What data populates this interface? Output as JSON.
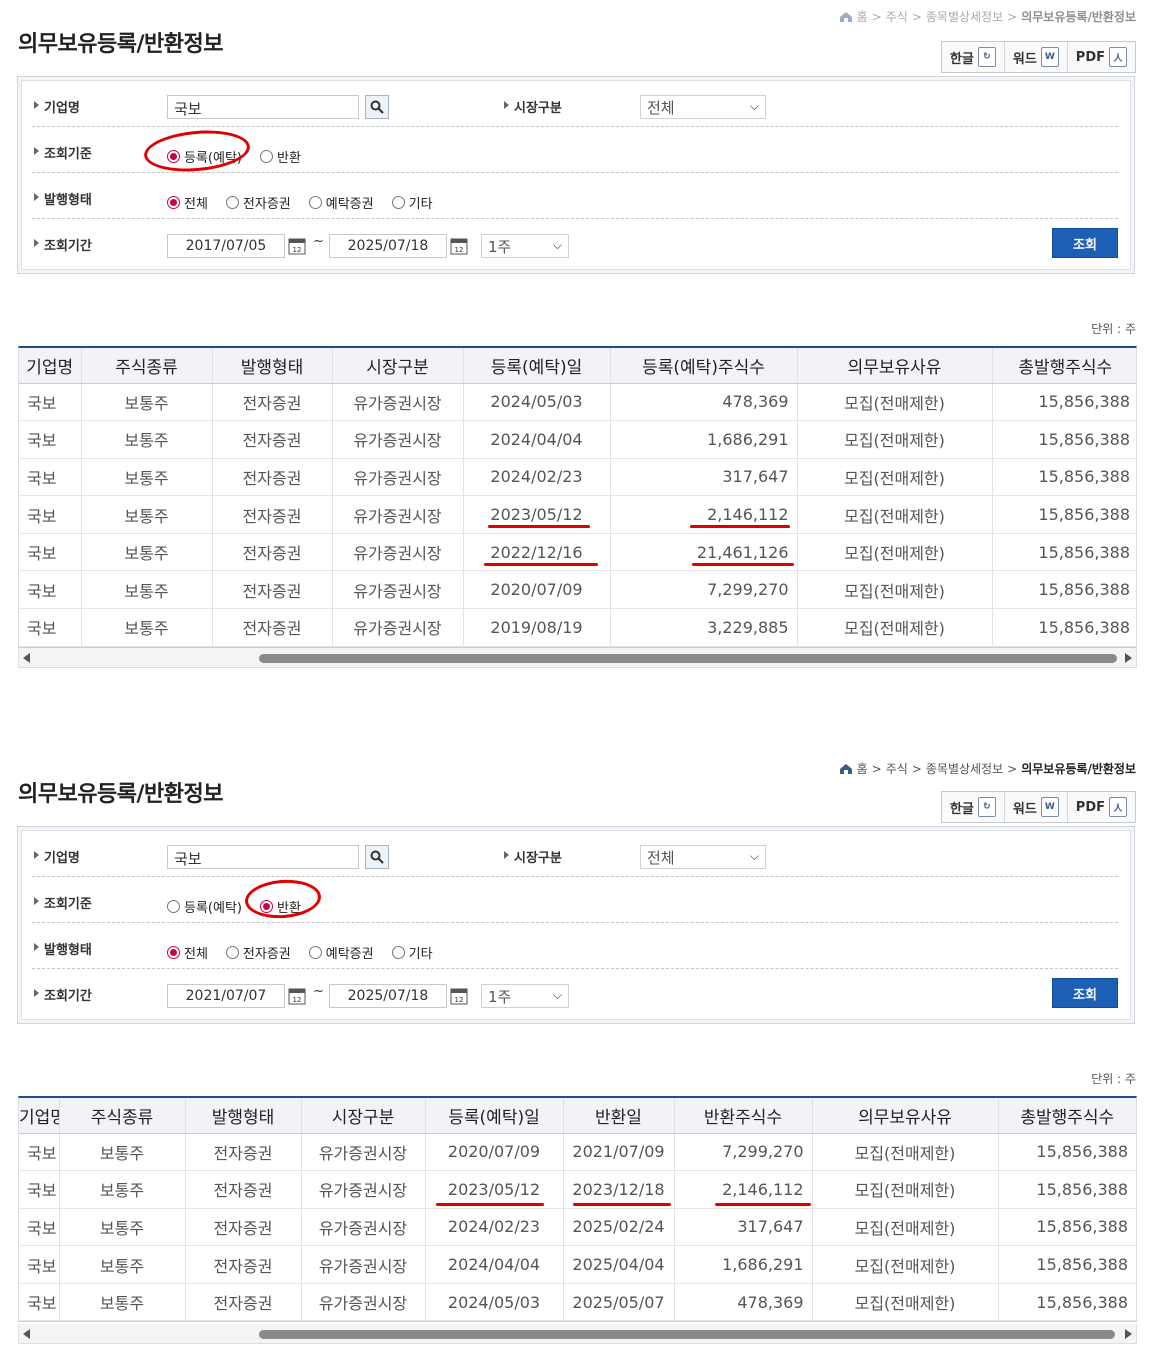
{
  "panel1": {
    "breadcrumb": [
      "홈",
      "주식",
      "종목별상세정보",
      "의무보유등록/반환정보"
    ],
    "title": "의무보유등록/반환정보",
    "export": [
      "한글",
      "워드",
      "PDF"
    ],
    "form": {
      "company_label": "기업명",
      "company_value": "국보",
      "market_label": "시장구분",
      "market_value": "전체",
      "basis_label": "조회기준",
      "basis_options": [
        "등록(예탁)",
        "반환"
      ],
      "basis_selected": "등록(예탁)",
      "type_label": "발행형태",
      "type_options": [
        "전체",
        "전자증권",
        "예탁증권",
        "기타"
      ],
      "type_selected": "전체",
      "period_label": "조회기간",
      "date_from": "2017/07/05",
      "date_to": "2025/07/18",
      "period_select": "1주",
      "submit": "조회"
    },
    "unit": "단위 : 주",
    "table": {
      "headers": [
        "기업명",
        "주식종류",
        "발행형태",
        "시장구분",
        "등록(예탁)일",
        "등록(예탁)주식수",
        "의무보유사유",
        "총발행주식수"
      ],
      "rows": [
        [
          "국보",
          "보통주",
          "전자증권",
          "유가증권시장",
          "2024/05/03",
          "478,369",
          "모집(전매제한)",
          "15,856,388"
        ],
        [
          "국보",
          "보통주",
          "전자증권",
          "유가증권시장",
          "2024/04/04",
          "1,686,291",
          "모집(전매제한)",
          "15,856,388"
        ],
        [
          "국보",
          "보통주",
          "전자증권",
          "유가증권시장",
          "2024/02/23",
          "317,647",
          "모집(전매제한)",
          "15,856,388"
        ],
        [
          "국보",
          "보통주",
          "전자증권",
          "유가증권시장",
          "2023/05/12",
          "2,146,112",
          "모집(전매제한)",
          "15,856,388"
        ],
        [
          "국보",
          "보통주",
          "전자증권",
          "유가증권시장",
          "2022/12/16",
          "21,461,126",
          "모집(전매제한)",
          "15,856,388"
        ],
        [
          "국보",
          "보통주",
          "전자증권",
          "유가증권시장",
          "2020/07/09",
          "7,299,270",
          "모집(전매제한)",
          "15,856,388"
        ],
        [
          "국보",
          "보통주",
          "전자증권",
          "유가증권시장",
          "2019/08/19",
          "3,229,885",
          "모집(전매제한)",
          "15,856,388"
        ]
      ]
    }
  },
  "panel2": {
    "breadcrumb": [
      "홈",
      "주식",
      "종목별상세정보",
      "의무보유등록/반환정보"
    ],
    "title": "의무보유등록/반환정보",
    "export": [
      "한글",
      "워드",
      "PDF"
    ],
    "form": {
      "company_label": "기업명",
      "company_value": "국보",
      "market_label": "시장구분",
      "market_value": "전체",
      "basis_label": "조회기준",
      "basis_options": [
        "등록(예탁)",
        "반환"
      ],
      "basis_selected": "반환",
      "type_label": "발행형태",
      "type_options": [
        "전체",
        "전자증권",
        "예탁증권",
        "기타"
      ],
      "type_selected": "전체",
      "period_label": "조회기간",
      "date_from": "2021/07/07",
      "date_to": "2025/07/18",
      "period_select": "1주",
      "submit": "조회"
    },
    "unit": "단위 : 주",
    "table": {
      "headers": [
        "기업명",
        "주식종류",
        "발행형태",
        "시장구분",
        "등록(예탁)일",
        "반환일",
        "반환주식수",
        "의무보유사유",
        "총발행주식수"
      ],
      "rows": [
        [
          "국보",
          "보통주",
          "전자증권",
          "유가증권시장",
          "2020/07/09",
          "2021/07/09",
          "7,299,270",
          "모집(전매제한)",
          "15,856,388"
        ],
        [
          "국보",
          "보통주",
          "전자증권",
          "유가증권시장",
          "2023/05/12",
          "2023/12/18",
          "2,146,112",
          "모집(전매제한)",
          "15,856,388"
        ],
        [
          "국보",
          "보통주",
          "전자증권",
          "유가증권시장",
          "2024/02/23",
          "2025/02/24",
          "317,647",
          "모집(전매제한)",
          "15,856,388"
        ],
        [
          "국보",
          "보통주",
          "전자증권",
          "유가증권시장",
          "2024/04/04",
          "2025/04/04",
          "1,686,291",
          "모집(전매제한)",
          "15,856,388"
        ],
        [
          "국보",
          "보통주",
          "전자증권",
          "유가증권시장",
          "2024/05/03",
          "2025/05/07",
          "478,369",
          "모집(전매제한)",
          "15,856,388"
        ]
      ]
    }
  },
  "colors": {
    "accent": "#1d5fb4",
    "radio_on": "#c8004a",
    "annotation": "#e00000"
  }
}
